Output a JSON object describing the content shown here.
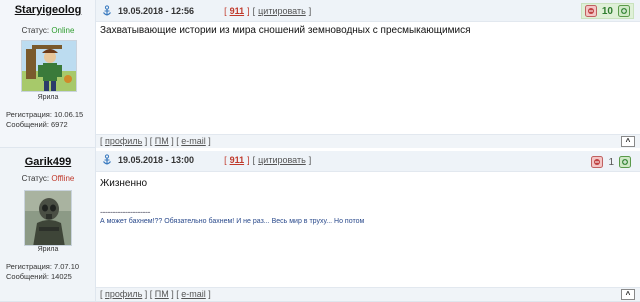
{
  "posts": [
    {
      "username": "Staryigeolog",
      "status_label": "Статус:",
      "status_value": "Online",
      "rank": "Ярила",
      "registration": "Регистрация: 10.06.15",
      "messages": "Сообщений: 6972",
      "date": "19.05.2018 - 12:56",
      "post_number": "911",
      "quote_label": "цитировать",
      "rating": "10",
      "body": "Захватывающие истории из мира сношений земноводных с пресмыкающимися",
      "signature_divider": "",
      "signature": "",
      "footer": {
        "profile": "профиль",
        "pm": "ПМ",
        "email": "e-mail",
        "top": "^"
      }
    },
    {
      "username": "Garik499",
      "status_label": "Статус:",
      "status_value": "Offline",
      "rank": "Ярила",
      "registration": "Регистрация: 7.07.10",
      "messages": "Сообщений: 14025",
      "date": "19.05.2018 - 13:00",
      "post_number": "911",
      "quote_label": "цитировать",
      "rating": "1",
      "body": "Жизненно",
      "signature_divider": "--------------------",
      "signature": "А может бахнем!?? Обязательно бахнем! И не раз... Весь мир в труху... Но потом",
      "footer": {
        "profile": "профиль",
        "pm": "ПМ",
        "email": "e-mail",
        "top": "^"
      }
    }
  ],
  "icons": {
    "post_link": "anchor-link-icon",
    "minus": "minus-vote-icon",
    "plus": "plus-vote-icon"
  },
  "colors": {
    "online": "#2e9d2e",
    "offline": "#c0392b",
    "post_number": "#c0392b",
    "signature": "#2a4a8c"
  }
}
